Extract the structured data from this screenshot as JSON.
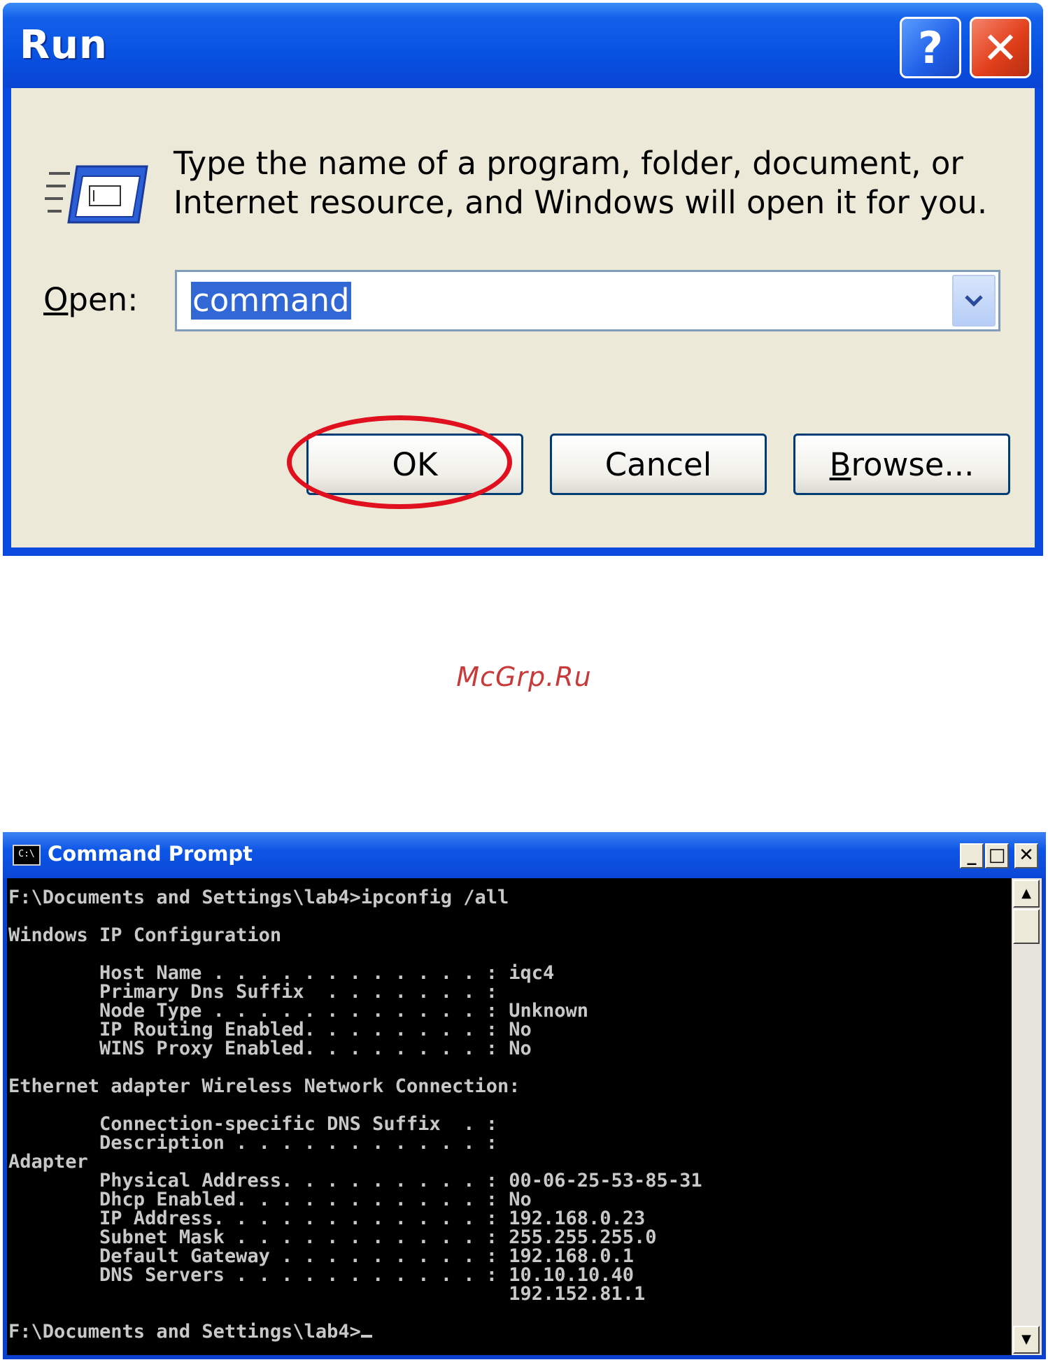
{
  "run_dialog": {
    "title": "Run",
    "help_button": "?",
    "close_button": "✕",
    "description_line1": "Type the name of a program, folder, document, or",
    "description_line2": "Internet resource, and Windows will open it for you.",
    "open_label_mnemonic": "O",
    "open_label_rest": "pen:",
    "open_value": "command",
    "ok_label": "OK",
    "cancel_label": "Cancel",
    "browse_label_mnemonic": "B",
    "browse_label_rest": "rowse...",
    "highlight_color": "#e0101e"
  },
  "watermark": "McGrp.Ru",
  "cmd_window": {
    "title": "Command Prompt",
    "icon_text": "C:\\",
    "min_label": "_",
    "max_label": "□",
    "close_label": "✕",
    "scroll_up": "▲",
    "scroll_down": "▼",
    "output": "F:\\Documents and Settings\\lab4>ipconfig /all\n\nWindows IP Configuration\n\n        Host Name . . . . . . . . . . . . : iqc4\n        Primary Dns Suffix  . . . . . . . :\n        Node Type . . . . . . . . . . . . : Unknown\n        IP Routing Enabled. . . . . . . . : No\n        WINS Proxy Enabled. . . . . . . . : No\n\nEthernet adapter Wireless Network Connection:\n\n        Connection-specific DNS Suffix  . :\n        Description . . . . . . . . . . . :\nAdapter\n        Physical Address. . . . . . . . . : 00-06-25-53-85-31\n        Dhcp Enabled. . . . . . . . . . . : No\n        IP Address. . . . . . . . . . . . : 192.168.0.23\n        Subnet Mask . . . . . . . . . . . : 255.255.255.0\n        Default Gateway . . . . . . . . . : 192.168.0.1\n        DNS Servers . . . . . . . . . . . : 10.10.10.40\n                                            192.152.81.1\n\nF:\\Documents and Settings\\lab4>"
  }
}
